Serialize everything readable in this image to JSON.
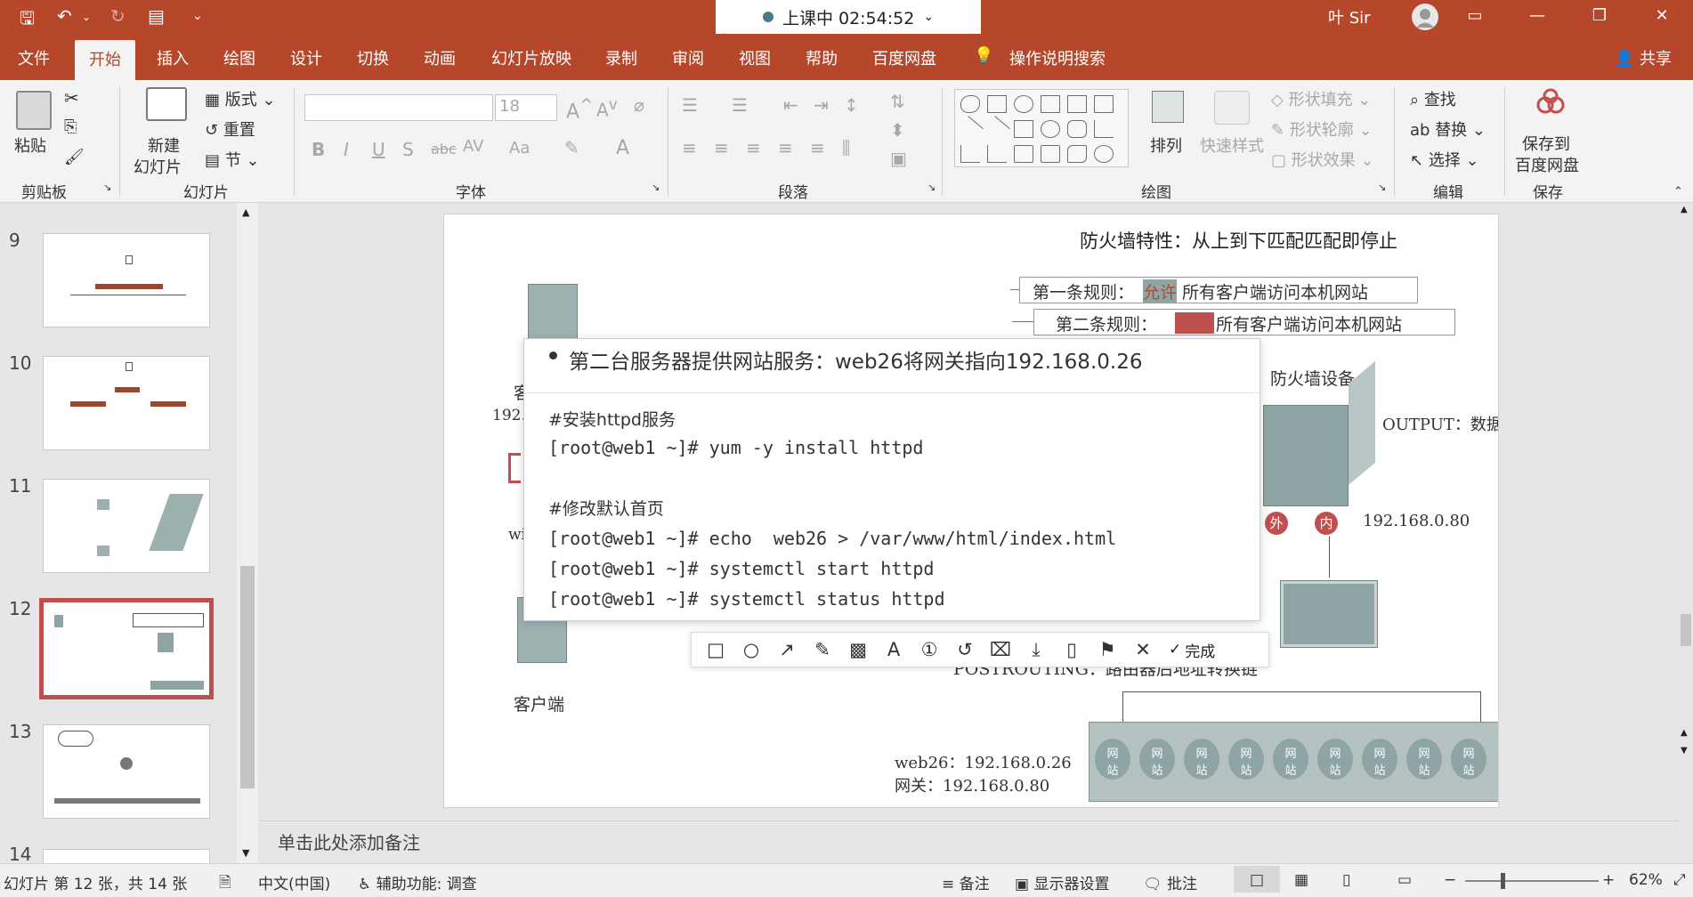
{
  "titlebar": {
    "recording": "上课中 02:54:52",
    "user": "叶 Sir"
  },
  "menu": {
    "tabs": [
      "文件",
      "开始",
      "插入",
      "绘图",
      "设计",
      "切换",
      "动画",
      "幻灯片放映",
      "录制",
      "审阅",
      "视图",
      "帮助",
      "百度网盘"
    ],
    "active": "开始",
    "tell_me": "操作说明搜索",
    "share": "共享"
  },
  "ribbon": {
    "clipboard": {
      "paste": "粘贴",
      "label": "剪贴板"
    },
    "slides": {
      "new_slide_1": "新建",
      "new_slide_2": "幻灯片",
      "layout": "版式",
      "reset": "重置",
      "section": "节",
      "label": "幻灯片"
    },
    "font": {
      "size": "18",
      "label": "字体"
    },
    "paragraph": {
      "label": "段落"
    },
    "drawing": {
      "arrange": "排列",
      "quick_styles": "快速样式",
      "fill": "形状填充",
      "outline": "形状轮廓",
      "effects": "形状效果",
      "label": "绘图"
    },
    "editing": {
      "find": "查找",
      "replace": "替换",
      "select": "选择",
      "label": "编辑"
    },
    "save": {
      "line1": "保存到",
      "line2": "百度网盘",
      "label": "保存"
    }
  },
  "thumbnails": [
    {
      "number": "9"
    },
    {
      "number": "10"
    },
    {
      "number": "11"
    },
    {
      "number": "12",
      "selected": true
    },
    {
      "number": "13"
    },
    {
      "number": "14"
    }
  ],
  "slide": {
    "heading": "防火墙特性：从上到下匹配匹配即停止",
    "rule1_prefix": "第一条规则：",
    "rule1_highlight": "允许",
    "rule1_rest": "所有客户端访问本机网站",
    "rule2_prefix": "第二条规则：",
    "rule2_rest": "所有客户端访问本机网站",
    "firewall_label": "防火墙设备",
    "output_chain": "OUTPUT：数据包出站链",
    "outer": "外",
    "inner": "内",
    "firewall_ip": "192.168.0.80",
    "client_partial": "客",
    "ip_partial": "192.",
    "wi_partial": "wi",
    "postrouting": "POSTROUTING：路由器后地址转换链",
    "client_label": "客户端",
    "web26_line": "web26：192.168.0.26",
    "gateway_line": "网关：192.168.0.80",
    "site_line1": "网",
    "site_line2": "站"
  },
  "popup": {
    "title": "第二台服务器提供网站服务：web26将网关指向192.168.0.26",
    "comment1": "#安装httpd服务",
    "cmd1": "[root@web1 ~]# yum -y install httpd",
    "comment2": "#修改默认首页",
    "cmd2": "[root@web1 ~]# echo  web26 > /var/www/html/index.html",
    "cmd3": "[root@web1 ~]# systemctl start httpd",
    "cmd4": "[root@web1 ~]# systemctl status httpd"
  },
  "draw_toolbar": {
    "done": "完成"
  },
  "notes": {
    "placeholder": "单击此处添加备注"
  },
  "status": {
    "slide_info": "幻灯片 第 12 张，共 14 张",
    "language": "中文(中国)",
    "accessibility": "辅助功能: 调查",
    "notes": "备注",
    "display": "显示器设置",
    "comments": "批注",
    "zoom": "62%"
  },
  "colors": {
    "accent": "#b7472a",
    "highlight": "#c0504d",
    "device": "#8fa4a4"
  }
}
